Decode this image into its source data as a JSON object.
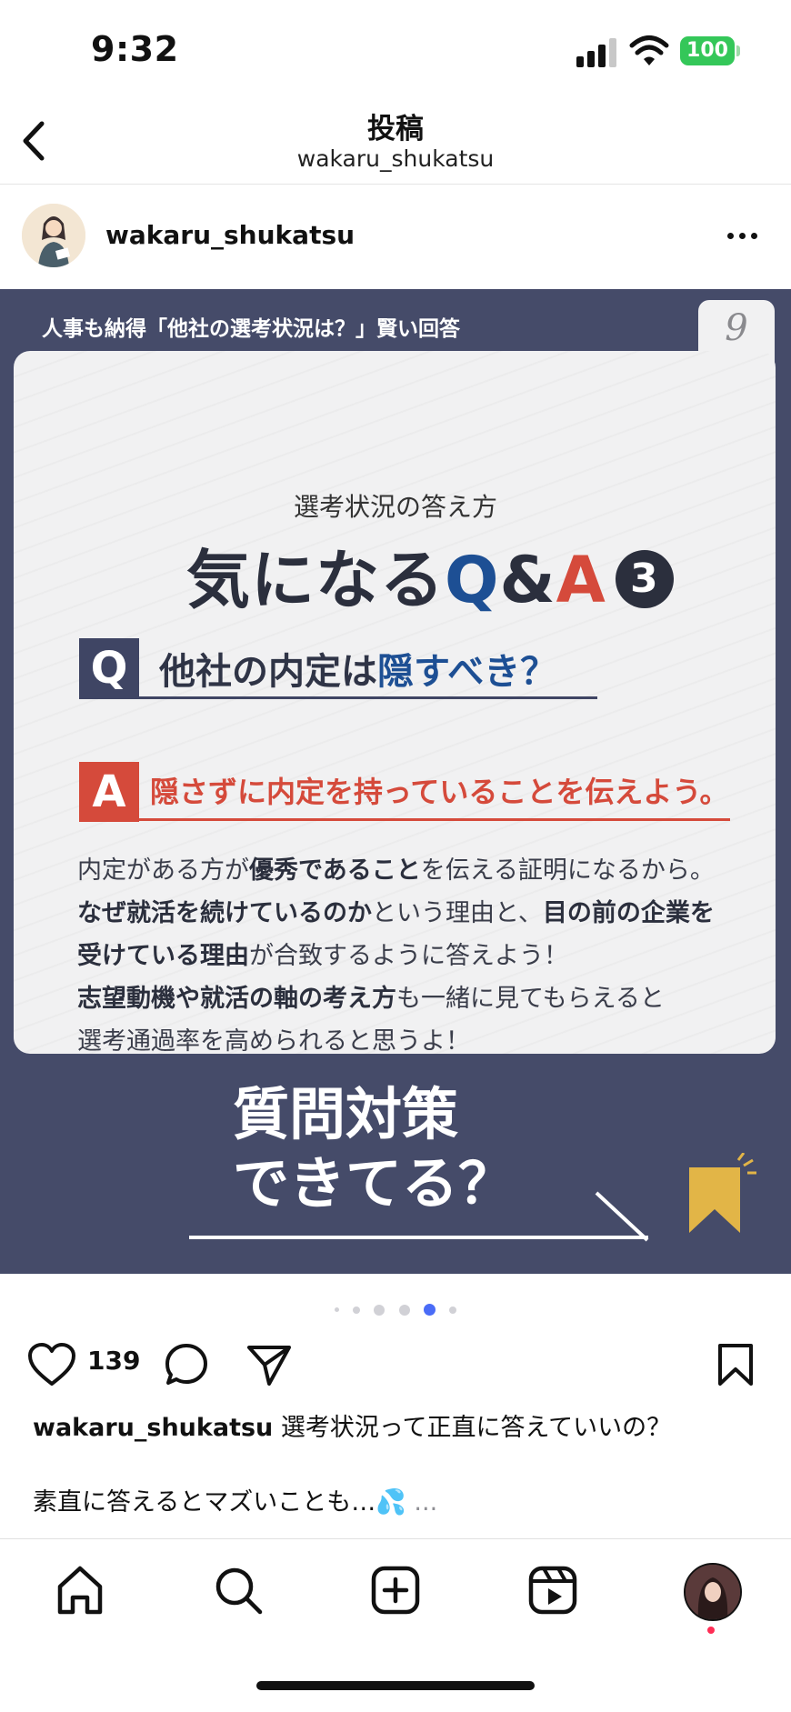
{
  "status_bar": {
    "time": "9:32",
    "battery": "100",
    "signal_icon": "cellular-signal-icon",
    "wifi_icon": "wifi-icon"
  },
  "header": {
    "title": "投稿",
    "subtitle": "wakaru_shukatsu",
    "back_icon": "chevron-left-icon"
  },
  "author": {
    "name": "wakaru_shukatsu",
    "more_icon": "more-horizontal-icon"
  },
  "post": {
    "banner": "人事も納得「他社の選考状況は？」賢い回答",
    "page_number": "9",
    "subtitle": "選考状況の答え方",
    "title_main": "気になる",
    "title_q": "Q",
    "title_amp": "&",
    "title_a": "A",
    "title_num": "3",
    "q_label": "Q",
    "q_text": "他社の内定は",
    "q_highlight": "隠すべき？",
    "a_label": "A",
    "a_text": "隠さずに内定を持っていることを伝えよう。",
    "body": {
      "l1_a": "内定がある方が",
      "l1_b": "優秀であること",
      "l1_c": "を伝える証明になるから。",
      "l2_a": "なぜ就活を続けているのか",
      "l2_b": "という理由と、",
      "l2_c": "目の前の企業を",
      "l3_a": "受けている理由",
      "l3_b": "が合致するように答えよう！",
      "l4_a": "志望動機や就活の軸の考え方",
      "l4_b": "も一緒に見てもらえると",
      "l5": "選考通過率を高められると思うよ！"
    },
    "cta_line1": "質問対策",
    "cta_line2": "できてる？",
    "accent_navy": "#454b69",
    "accent_red": "#d54a3b",
    "accent_blue": "#1d4f94",
    "accent_gold": "#e2b547"
  },
  "carousel": {
    "dot_count": 6,
    "active_index": 4
  },
  "actions": {
    "likes": "139",
    "like_icon": "heart-icon",
    "comment_icon": "comment-icon",
    "share_icon": "send-icon",
    "save_icon": "bookmark-icon"
  },
  "caption": {
    "user": "wakaru_shukatsu",
    "text": " 選考状況って正直に答えていいの？",
    "line2": "素直に答えるとマズいことも…",
    "emoji": "💦",
    "more": " ..."
  },
  "nav": {
    "home": "home-icon",
    "search": "search-icon",
    "create": "create-post-icon",
    "reels": "reels-icon",
    "profile": "profile-avatar"
  }
}
